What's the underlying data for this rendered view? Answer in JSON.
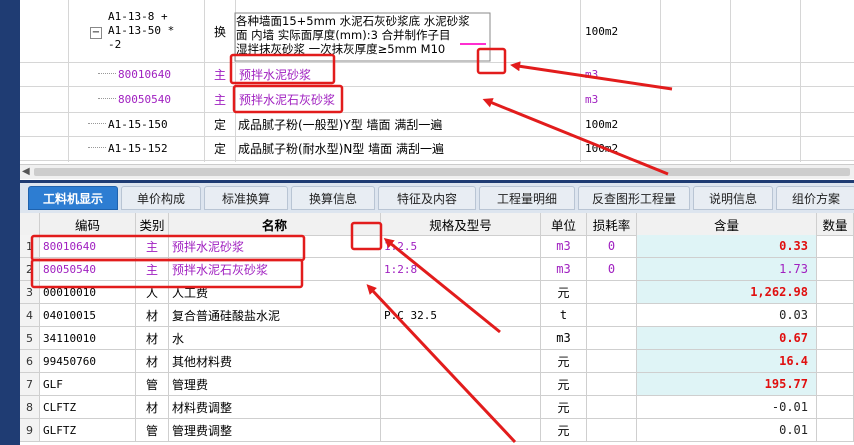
{
  "colors": {
    "accent": "#2d7dd2",
    "annotation_red": "#e21c1c",
    "purple_text": "#a020c0",
    "highlight_cyan": "#dff4f6"
  },
  "upper_grid": {
    "rows": [
      {
        "code_lines": [
          "A1-13-8 +",
          "A1-13-50 *",
          "-2"
        ],
        "type": "换",
        "name_lines": [
          "各种墙面15+5mm 水泥石灰砂浆底 水泥砂浆",
          "面 内墙  实际面厚度(mm):3  合并制作子目",
          "湿拌抹灰砂浆 一次抹灰厚度≥5mm M10"
        ],
        "unit": "100m2",
        "expander": "−"
      },
      {
        "code": "80010640",
        "type": "主",
        "name": "预拌水泥砂浆",
        "unit": "m3"
      },
      {
        "code": "80050540",
        "type": "主",
        "name": "预拌水泥石灰砂浆",
        "unit": "m3"
      },
      {
        "code": "A1-15-150",
        "type": "定",
        "name": "成品腻子粉(一般型)Y型 墙面 满刮一遍",
        "unit": "100m2"
      },
      {
        "code": "A1-15-152",
        "type": "定",
        "name": "成品腻子粉(耐水型)N型 墙面 满刮一遍",
        "unit": "100m2"
      }
    ]
  },
  "tabs": [
    "工料机显示",
    "单价构成",
    "标准换算",
    "换算信息",
    "特征及内容",
    "工程量明细",
    "反查图形工程量",
    "说明信息",
    "组价方案"
  ],
  "lower_grid": {
    "headers": {
      "code": "编码",
      "type": "类别",
      "name": "名称",
      "spec": "规格及型号",
      "unit": "单位",
      "loss": "损耗率",
      "qty": "含量",
      "count": "数量"
    },
    "rows": [
      {
        "num": "1",
        "code": "80010640",
        "type": "主",
        "name": "预拌水泥砂浆",
        "spec": "1:2.5",
        "unit": "m3",
        "loss": "0",
        "qty": "0.33",
        "purple": true,
        "red": true
      },
      {
        "num": "2",
        "code": "80050540",
        "type": "主",
        "name": "预拌水泥石灰砂浆",
        "spec": "1:2:8",
        "unit": "m3",
        "loss": "0",
        "qty": "1.73",
        "purple": true,
        "red": false
      },
      {
        "num": "3",
        "code": "00010010",
        "type": "人",
        "name": "人工费",
        "spec": "",
        "unit": "元",
        "loss": "",
        "qty": "1,262.98",
        "purple": false,
        "red": true
      },
      {
        "num": "4",
        "code": "04010015",
        "type": "材",
        "name": "复合普通硅酸盐水泥",
        "spec": "P.C 32.5",
        "unit": "t",
        "loss": "",
        "qty": "0.03",
        "purple": false,
        "red": false
      },
      {
        "num": "5",
        "code": "34110010",
        "type": "材",
        "name": "水",
        "spec": "",
        "unit": "m3",
        "loss": "",
        "qty": "0.67",
        "purple": false,
        "red": true
      },
      {
        "num": "6",
        "code": "99450760",
        "type": "材",
        "name": "其他材料费",
        "spec": "",
        "unit": "元",
        "loss": "",
        "qty": "16.4",
        "purple": false,
        "red": true
      },
      {
        "num": "7",
        "code": "GLF",
        "type": "管",
        "name": "管理费",
        "spec": "",
        "unit": "元",
        "loss": "",
        "qty": "195.77",
        "purple": false,
        "red": true
      },
      {
        "num": "8",
        "code": "CLFTZ",
        "type": "材",
        "name": "材料费调整",
        "spec": "",
        "unit": "元",
        "loss": "",
        "qty": "-0.01",
        "purple": false,
        "red": false
      },
      {
        "num": "9",
        "code": "GLFTZ",
        "type": "管",
        "name": "管理费调整",
        "spec": "",
        "unit": "元",
        "loss": "",
        "qty": "0.01",
        "purple": false,
        "red": false
      }
    ]
  }
}
